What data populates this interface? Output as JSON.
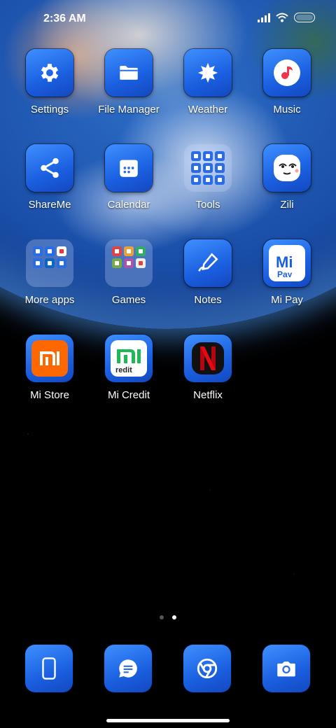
{
  "status_bar": {
    "time": "2:36 AM",
    "icons": [
      "signal-icon",
      "wifi-icon",
      "battery-icon"
    ]
  },
  "apps": [
    {
      "name": "settings",
      "label": "Settings",
      "icon": "gear-icon"
    },
    {
      "name": "file-manager",
      "label": "File Manager",
      "icon": "folder-icon"
    },
    {
      "name": "weather",
      "label": "Weather",
      "icon": "weather-icon"
    },
    {
      "name": "music",
      "label": "Music",
      "icon": "music-icon"
    },
    {
      "name": "shareme",
      "label": "ShareMe",
      "icon": "share-icon"
    },
    {
      "name": "calendar",
      "label": "Calendar",
      "icon": "calendar-icon"
    },
    {
      "name": "tools",
      "label": "Tools",
      "icon": "folder-grid-icon"
    },
    {
      "name": "zili",
      "label": "Zili",
      "icon": "zili-face-icon"
    },
    {
      "name": "more-apps",
      "label": "More apps",
      "icon": "folder-grid-icon"
    },
    {
      "name": "games",
      "label": "Games",
      "icon": "folder-grid-icon"
    },
    {
      "name": "notes",
      "label": "Notes",
      "icon": "notes-pen-icon"
    },
    {
      "name": "mi-pay",
      "label": "Mi Pay",
      "icon": "mi-pay-icon"
    },
    {
      "name": "mi-store",
      "label": "Mi Store",
      "icon": "mi-logo-icon"
    },
    {
      "name": "mi-credit",
      "label": "Mi Credit",
      "icon": "mi-credit-icon"
    },
    {
      "name": "netflix",
      "label": "Netflix",
      "icon": "netflix-icon"
    }
  ],
  "pages": {
    "count": 2,
    "active": 2
  },
  "dock": [
    {
      "name": "phone",
      "icon": "phone-icon"
    },
    {
      "name": "messages",
      "icon": "message-icon"
    },
    {
      "name": "browser",
      "icon": "chrome-icon"
    },
    {
      "name": "camera",
      "icon": "camera-icon"
    }
  ],
  "colors": {
    "icon_tile": "#2a6be6",
    "mi_orange": "#ff6700",
    "netflix_red": "#e50914",
    "mi_credit_green": "#1db954"
  }
}
